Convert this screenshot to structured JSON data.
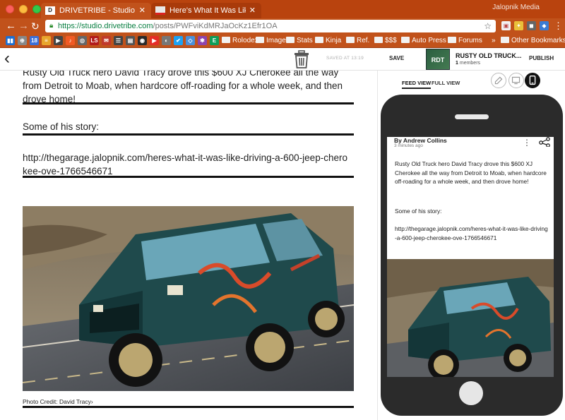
{
  "browser": {
    "tabs": [
      {
        "title": "DRIVETRIBE - Studio",
        "favicon": "D"
      },
      {
        "title": "Here's What It Was Like Driving",
        "favicon": ""
      }
    ],
    "profile": "Jalopnik Media",
    "url_host": "https://studio.drivetribe.com",
    "url_path": "/posts/PWFviKdMRJaOcKz1Efr1OA",
    "extensions": [
      "18",
      "LS"
    ],
    "bookmarks": [
      {
        "label": "Rolodex",
        "icon": "folder"
      },
      {
        "label": "Images",
        "icon": "folder"
      },
      {
        "label": "Stats",
        "icon": "folder"
      },
      {
        "label": "Kinja",
        "icon": "folder"
      },
      {
        "label": "Ref.",
        "icon": "folder"
      },
      {
        "label": "$$$",
        "icon": "folder"
      },
      {
        "label": "Auto Press",
        "icon": "folder"
      },
      {
        "label": "Forums",
        "icon": "folder"
      }
    ],
    "bookmark_overflow": "»",
    "other_bookmarks": "Other Bookmarks",
    "bookmark_icon_labels": [
      "LS",
      "E"
    ]
  },
  "toolbar": {
    "saved_at": "SAVED AT 13:19",
    "save_label": "SAVE",
    "publish_label": "PUBLISH",
    "tribe": {
      "thumb_text": "RDT",
      "name": "RUSTY OLD TRUCK...",
      "member_count": "1",
      "member_label": "members"
    }
  },
  "editor": {
    "paragraphs": [
      "Rusty Old Truck hero David Tracy drove this $600 XJ Cherokee all the way from Detroit to Moab, when hardcore off-roading for a whole week, and then drove home!",
      "Some of his story:",
      "http://thegarage.jalopnik.com/heres-what-it-was-like-driving-a-600-jeep-cherokee-ove-1766546671"
    ],
    "photo_credit": "Photo Credit: David Tracy›"
  },
  "preview": {
    "tabs": [
      "FEED VIEW",
      "FULL VIEW"
    ],
    "active_tab": "FEED VIEW",
    "device_modes": [
      "pencil",
      "desktop",
      "mobile"
    ],
    "selected_device": "mobile",
    "author": "By Andrew Collins",
    "time_ago": "3 minutes ago",
    "body": [
      "Rusty Old Truck hero David Tracy drove this $600 XJ Cherokee all the way from Detroit to Moab, when hardcore off-roading for a whole week, and then drove home!",
      "Some of his story:",
      "http://thegarage.jalopnik.com/heres-what-it-was-like-driving-a-600-jeep-cherokee-ove-1766546671"
    ]
  },
  "colors": {
    "chrome": "#c1521b",
    "phone": "#2b2b2b",
    "rule": "#111111"
  }
}
